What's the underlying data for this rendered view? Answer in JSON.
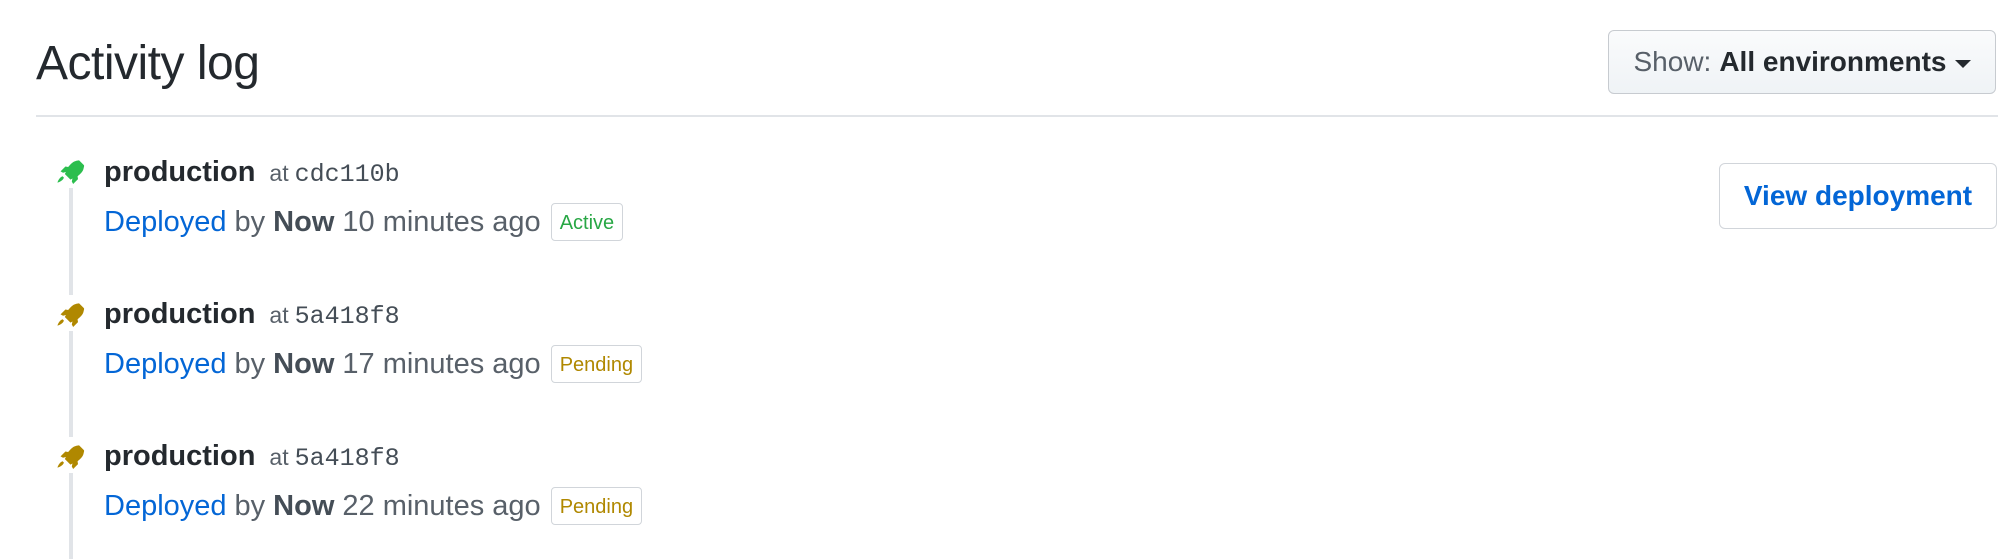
{
  "header": {
    "title": "Activity log",
    "filter_prefix": "Show:",
    "filter_value": "All environments"
  },
  "entries": [
    {
      "environment": "production",
      "at_label": "at",
      "sha": "cdc110b",
      "action": "Deployed",
      "by_label": "by",
      "actor": "Now",
      "time": "10 minutes ago",
      "status": "Active",
      "status_color": "#28a745",
      "icon": "rocket-icon",
      "icon_color": "#2cbe4e"
    },
    {
      "environment": "production",
      "at_label": "at",
      "sha": "5a418f8",
      "action": "Deployed",
      "by_label": "by",
      "actor": "Now",
      "time": "17 minutes ago",
      "status": "Pending",
      "status_color": "#b08800",
      "icon": "rocket-icon",
      "icon_color": "#b08800"
    },
    {
      "environment": "production",
      "at_label": "at",
      "sha": "5a418f8",
      "action": "Deployed",
      "by_label": "by",
      "actor": "Now",
      "time": "22 minutes ago",
      "status": "Pending",
      "status_color": "#b08800",
      "icon": "rocket-icon",
      "icon_color": "#b08800"
    }
  ],
  "view_deployment_label": "View deployment"
}
